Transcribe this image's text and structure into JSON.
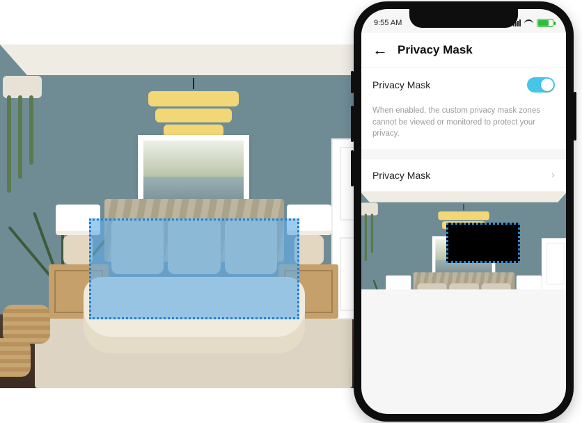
{
  "statusbar": {
    "time": "9:55 AM"
  },
  "header": {
    "title": "Privacy Mask"
  },
  "toggle_row": {
    "label": "Privacy Mask",
    "state": "on"
  },
  "description": "When enabled, the custom privacy mask zones cannot be viewed or monitored to protect your privacy.",
  "nav_row": {
    "label": "Privacy Mask"
  },
  "icons": {
    "back": "←",
    "chevron": "›"
  },
  "colors": {
    "accent_toggle": "#46c6e6",
    "mask_fill": "rgba(97,172,232,0.62)",
    "mask_border": "#1f7fd1"
  }
}
